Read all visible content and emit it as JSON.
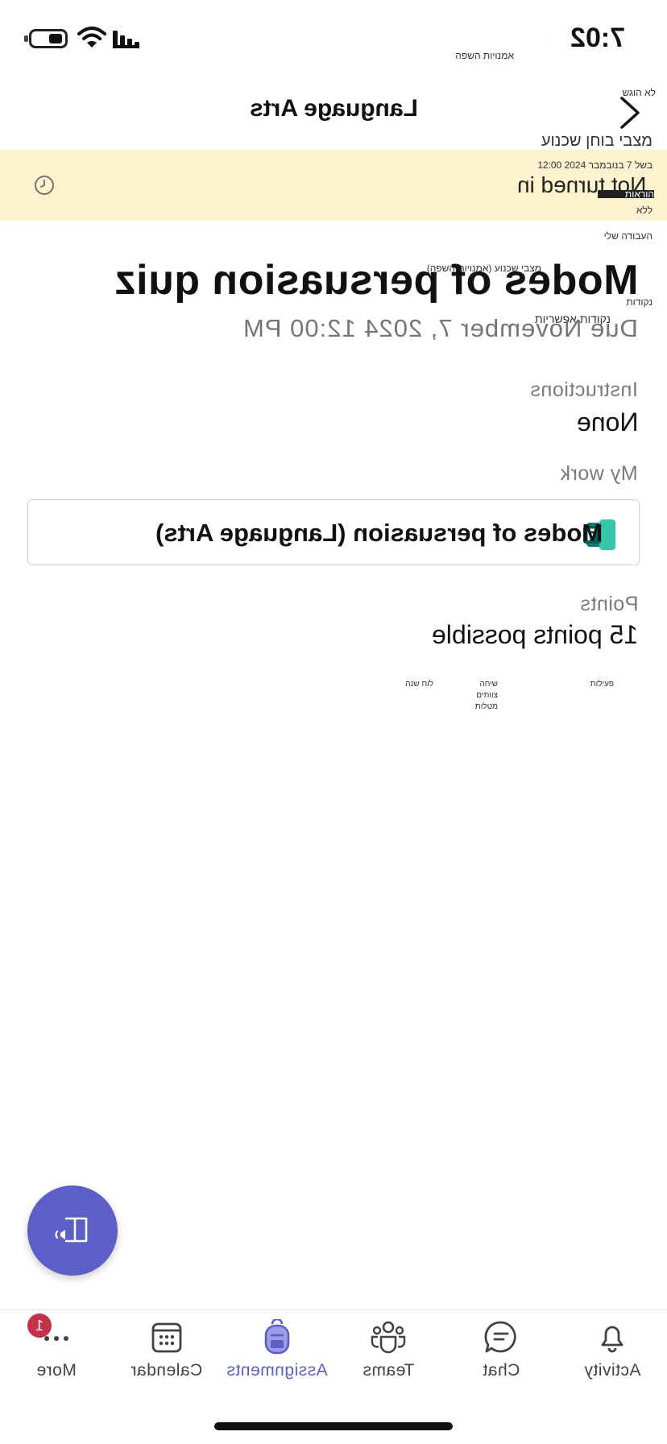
{
  "status_bar": {
    "time": "7:02"
  },
  "header": {
    "title": "Language Arts",
    "back_label": "לא הוגש"
  },
  "banner": {
    "status": "Not turned in"
  },
  "assignment": {
    "title": "Modes of persuasion quiz",
    "due": "Due November 7, 2024 12:00 PM"
  },
  "instructions": {
    "label": "Instructions",
    "value": "None"
  },
  "my_work": {
    "label": "My work",
    "item": "Modes of persuasion (Language Arts)"
  },
  "points": {
    "label": "Points",
    "value": "15 points possible"
  },
  "overlay_labels": {
    "focus_mode": "אמנויות השפה",
    "quiz_name": "מצבי בוחן שכנוע",
    "due_heb": "בשל 7 בנובמבר 2024 12:00",
    "instructions_heb": "הוראות",
    "none_heb": "ללא",
    "my_work_heb": "העבודה שלי",
    "quiz_name_full": "מצבי שכנוע (אמנויות השפה)",
    "points_heb": "נקודות",
    "points_possible_heb": "נקודות אפשריות",
    "tab_activity_heb": "פעילות",
    "tab_chat_heb": "שיחה",
    "tab_teams_heb": "צוותים",
    "tab_assignments_heb": "מטלות",
    "tab_calendar_heb": "לוח שנה"
  },
  "tabs": [
    {
      "id": "activity",
      "label": "Activity",
      "icon": "bell-icon"
    },
    {
      "id": "chat",
      "label": "Chat",
      "icon": "chat-icon"
    },
    {
      "id": "teams",
      "label": "Teams",
      "icon": "teams-icon"
    },
    {
      "id": "assignments",
      "label": "Assignments",
      "icon": "backpack-icon",
      "active": true
    },
    {
      "id": "calendar",
      "label": "Calendar",
      "icon": "calendar-icon"
    },
    {
      "id": "more",
      "label": "More",
      "icon": "more-icon",
      "badge": "1"
    }
  ],
  "colors": {
    "accent": "#5b5fc7",
    "banner": "#fdf3cf",
    "badge": "#c4314b"
  }
}
